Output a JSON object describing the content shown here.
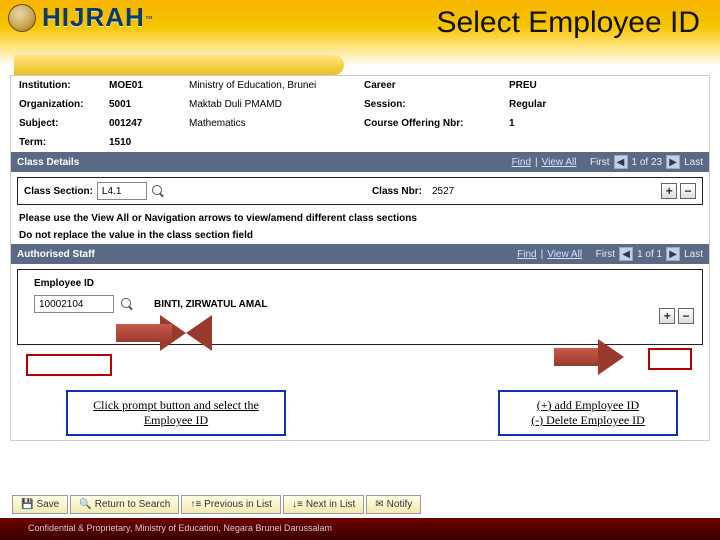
{
  "header": {
    "brand": "HIJRAH",
    "title": "Select Employee ID"
  },
  "info": {
    "r1": {
      "l": "Institution:",
      "v": "MOE01",
      "d": "Ministry of Education, Brunei",
      "l2": "Career",
      "v2": "PREU"
    },
    "r2": {
      "l": "Organization:",
      "v": "5001",
      "d": "Maktab Duli PMAMD",
      "l2": "Session:",
      "v2": "Regular"
    },
    "r3": {
      "l": "Subject:",
      "v": "001247",
      "d": "Mathematics",
      "l2": "Course Offering Nbr:",
      "v2": "1"
    },
    "r4": {
      "l": "Term:",
      "v": "1510",
      "d": "",
      "l2": "",
      "v2": ""
    }
  },
  "class_details": {
    "bar_title": "Class Details",
    "find": "Find",
    "viewall": "View All",
    "first": "First",
    "counter": "1 of 23",
    "last": "Last",
    "section_label": "Class Section:",
    "section_value": "L4.1",
    "nbr_label": "Class Nbr:",
    "nbr_value": "2527"
  },
  "hints": {
    "line1": "Please use the View All or Navigation arrows to view/amend different class sections",
    "line2": "Do not replace the value in the class section field"
  },
  "auth": {
    "bar_title": "Authorised Staff",
    "find": "Find",
    "viewall": "View All",
    "first": "First",
    "counter": "1 of 1",
    "last": "Last",
    "emp_label": "Employee ID",
    "emp_value": "10002104",
    "emp_name": "BINTI, ZIRWATUL AMAL"
  },
  "callouts": {
    "left": "Click prompt button and select the Employee ID",
    "right1": "(+) add Employee ID",
    "right2": "(-) Delete Employee ID"
  },
  "footer": {
    "save": "Save",
    "return": "Return to Search",
    "prev": "Previous in List",
    "next": "Next in List",
    "notify": "Notify",
    "conf": "Confidential & Proprietary, Ministry of Education, Negara Brunei Darussalam"
  }
}
